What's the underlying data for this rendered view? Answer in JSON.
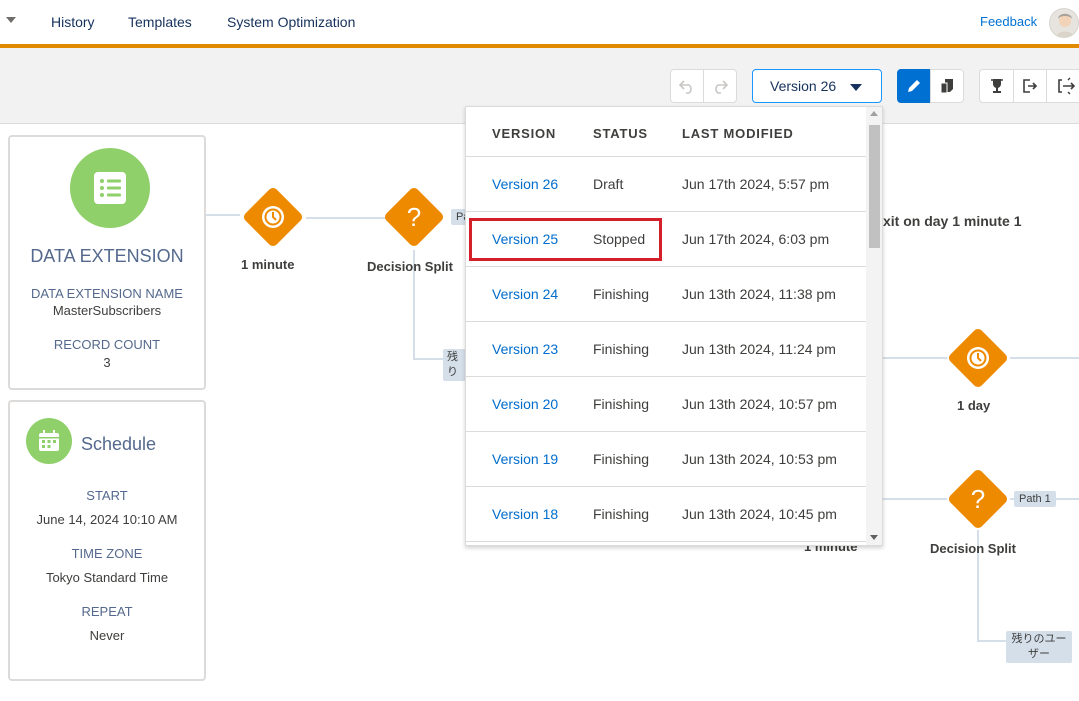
{
  "nav": {
    "items": [
      "History",
      "Templates",
      "System Optimization"
    ],
    "feedback": "Feedback"
  },
  "toolbar": {
    "version_selected": "Version 26"
  },
  "data_extension_card": {
    "title": "DATA EXTENSION",
    "name_label": "DATA EXTENSION NAME",
    "name_value": "MasterSubscribers",
    "count_label": "RECORD COUNT",
    "count_value": "3"
  },
  "schedule_card": {
    "title": "Schedule",
    "start_label": "START",
    "start_value": "June 14, 2024 10:10 AM",
    "timezone_label": "TIME ZONE",
    "timezone_value": "Tokyo Standard Time",
    "repeat_label": "REPEAT",
    "repeat_value": "Never"
  },
  "canvas": {
    "wait1_label": "1 minute",
    "split1_label": "Decision Split",
    "path_tag_1": "Pa",
    "jp_tag_1": "残り",
    "exit_text": "xit on day 1 minute 1",
    "wait2_label": "1 day",
    "wait3_label": "1 minute",
    "split2_label": "Decision Split",
    "path_tag_2": "Path 1",
    "jp_tag_2_line1": "残りのユー",
    "jp_tag_2_line2": "ザー"
  },
  "version_dropdown": {
    "headers": {
      "version": "VERSION",
      "status": "STATUS",
      "last_modified": "LAST MODIFIED"
    },
    "rows": [
      {
        "version": "Version 26",
        "status": "Draft",
        "last_modified": "Jun 17th 2024, 5:57 pm"
      },
      {
        "version": "Version 25",
        "status": "Stopped",
        "last_modified": "Jun 17th 2024, 6:03 pm"
      },
      {
        "version": "Version 24",
        "status": "Finishing",
        "last_modified": "Jun 13th 2024, 11:38 pm"
      },
      {
        "version": "Version 23",
        "status": "Finishing",
        "last_modified": "Jun 13th 2024, 11:24 pm"
      },
      {
        "version": "Version 20",
        "status": "Finishing",
        "last_modified": "Jun 13th 2024, 10:57 pm"
      },
      {
        "version": "Version 19",
        "status": "Finishing",
        "last_modified": "Jun 13th 2024, 10:53 pm"
      },
      {
        "version": "Version 18",
        "status": "Finishing",
        "last_modified": "Jun 13th 2024, 10:45 pm"
      }
    ]
  },
  "colors": {
    "accent_orange": "#ee8a00",
    "brand_blue": "#0070d2",
    "green_icon": "#8fd06b",
    "highlight_red": "#d4202a"
  },
  "icons": [
    "chevron-down-icon",
    "undo-icon",
    "redo-icon",
    "edit-icon",
    "copy-icon",
    "trophy-icon",
    "exit-icon",
    "path-icon",
    "list-icon",
    "calendar-icon",
    "clock-icon",
    "question-icon"
  ]
}
